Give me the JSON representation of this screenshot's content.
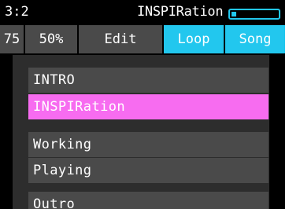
{
  "status": {
    "position": "3:2",
    "track_name": "INSPIRation",
    "level_fraction": 0.1,
    "accent_color": "#22c7ee"
  },
  "toolbar": {
    "bpm": "75",
    "volume": "50%",
    "edit_label": "Edit",
    "loop_label": "Loop",
    "song_label": "Song",
    "active": [
      "Loop",
      "Song"
    ]
  },
  "parts": {
    "selected": "INSPIRation",
    "selected_color": "#f76cf0",
    "items": [
      {
        "label": "INTRO"
      },
      {
        "label": "INSPIRation"
      },
      {
        "label": "Working"
      },
      {
        "label": "Playing"
      },
      {
        "label": "Outro"
      }
    ]
  }
}
